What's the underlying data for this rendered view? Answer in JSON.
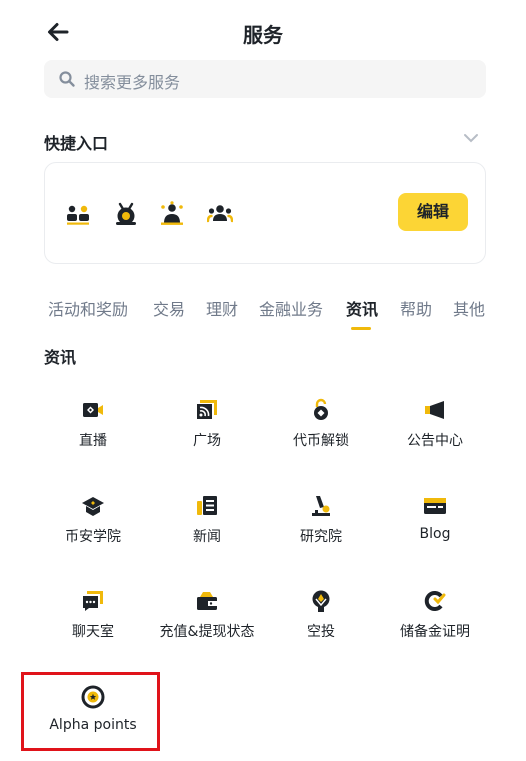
{
  "header": {
    "title": "服务",
    "back_icon": "arrow-left-icon"
  },
  "search": {
    "placeholder": "搜索更多服务",
    "icon": "search-icon"
  },
  "quick_access": {
    "title": "快捷入口",
    "expand_icon": "chevron-down-icon",
    "icons": [
      "referral-icon",
      "rewards-hub-icon",
      "community-icon",
      "users-icon"
    ],
    "edit_label": "编辑"
  },
  "tabs": {
    "items": [
      {
        "label": "活动和奖励"
      },
      {
        "label": "交易"
      },
      {
        "label": "理财"
      },
      {
        "label": "金融业务"
      },
      {
        "label": "资讯"
      },
      {
        "label": "帮助"
      },
      {
        "label": "其他"
      }
    ],
    "active_index": 4
  },
  "section": {
    "title": "资讯"
  },
  "grid": {
    "items": [
      {
        "label": "直播",
        "icon": "live-video-icon"
      },
      {
        "label": "广场",
        "icon": "square-feed-icon"
      },
      {
        "label": "代币解锁",
        "icon": "token-unlock-icon"
      },
      {
        "label": "公告中心",
        "icon": "megaphone-icon"
      },
      {
        "label": "币安学院",
        "icon": "academy-cap-icon"
      },
      {
        "label": "新闻",
        "icon": "news-icon"
      },
      {
        "label": "研究院",
        "icon": "microscope-icon"
      },
      {
        "label": "Blog",
        "icon": "blog-icon"
      },
      {
        "label": "聊天室",
        "icon": "chat-room-icon"
      },
      {
        "label": "充值&提现状态",
        "icon": "wallet-status-icon"
      },
      {
        "label": "空投",
        "icon": "airdrop-icon"
      },
      {
        "label": "储备金证明",
        "icon": "proof-of-reserves-icon"
      },
      {
        "label": "Alpha points",
        "icon": "alpha-points-icon"
      }
    ]
  },
  "colors": {
    "accent": "#fcd535",
    "brand_yellow": "#f0b90b",
    "text": "#1e2329",
    "muted": "#707a8a",
    "highlight": "#e0131a"
  }
}
